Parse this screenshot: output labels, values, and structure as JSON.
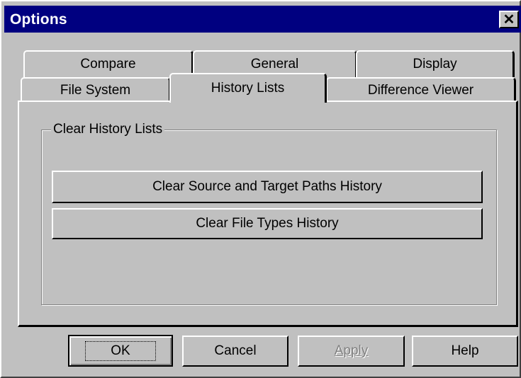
{
  "window": {
    "title": "Options",
    "close_label": "✕"
  },
  "tabs": {
    "row1": [
      {
        "label": "Compare"
      },
      {
        "label": "General"
      },
      {
        "label": "Display"
      }
    ],
    "row2": [
      {
        "label": "File System"
      },
      {
        "label": "History Lists",
        "active": true
      },
      {
        "label": "Difference Viewer"
      }
    ]
  },
  "panel": {
    "group_label": "Clear History Lists",
    "buttons": {
      "clear_paths": "Clear Source and Target Paths History",
      "clear_types": "Clear File Types History"
    }
  },
  "footer": {
    "ok": "OK",
    "cancel": "Cancel",
    "apply": "Apply",
    "help": "Help"
  },
  "colors": {
    "titlebar": "#000080",
    "face": "#c0c0c0",
    "disabled_text": "#808080"
  }
}
